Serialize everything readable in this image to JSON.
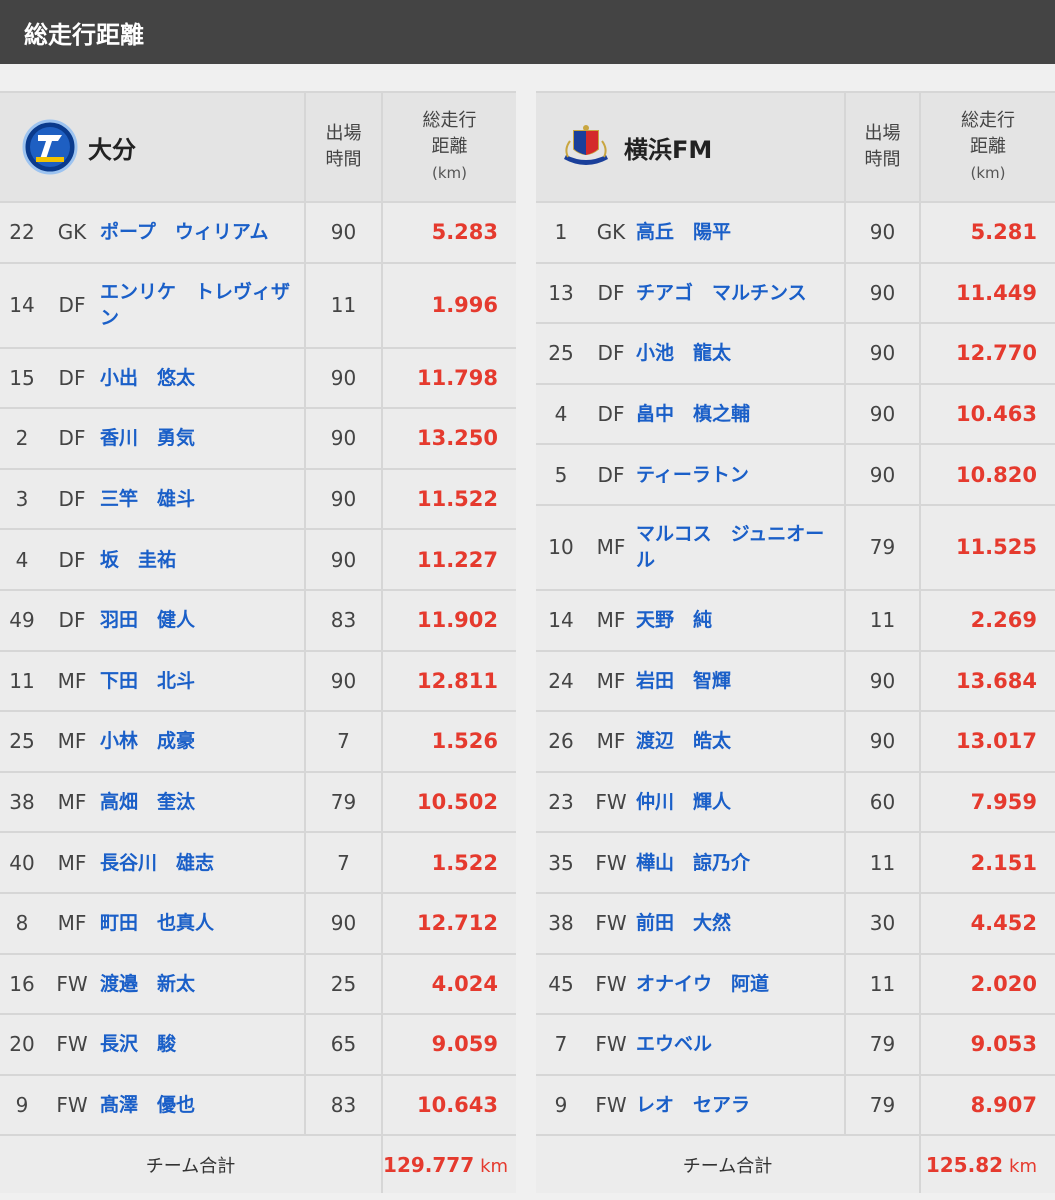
{
  "title": "総走行距離",
  "headers": {
    "minutes_l1": "出場",
    "minutes_l2": "時間",
    "dist_l1": "総走行",
    "dist_l2": "距離",
    "dist_unit": "(km)"
  },
  "total_label": "チーム合計",
  "unit": "km",
  "colors": {
    "accent": "#e53a2e",
    "link": "#1a5fc8",
    "titlebar": "#444444"
  },
  "left": {
    "team": "大分",
    "crest_icon": "oita-trinita-crest-icon",
    "players": [
      {
        "no": "22",
        "pos": "GK",
        "name": "ポープ　ウィリアム",
        "min": "90",
        "dist": "5.283"
      },
      {
        "no": "14",
        "pos": "DF",
        "name": "エンリケ　トレヴィザン",
        "min": "11",
        "dist": "1.996"
      },
      {
        "no": "15",
        "pos": "DF",
        "name": "小出　悠太",
        "min": "90",
        "dist": "11.798"
      },
      {
        "no": "2",
        "pos": "DF",
        "name": "香川　勇気",
        "min": "90",
        "dist": "13.250"
      },
      {
        "no": "3",
        "pos": "DF",
        "name": "三竿　雄斗",
        "min": "90",
        "dist": "11.522"
      },
      {
        "no": "4",
        "pos": "DF",
        "name": "坂　圭祐",
        "min": "90",
        "dist": "11.227"
      },
      {
        "no": "49",
        "pos": "DF",
        "name": "羽田　健人",
        "min": "83",
        "dist": "11.902"
      },
      {
        "no": "11",
        "pos": "MF",
        "name": "下田　北斗",
        "min": "90",
        "dist": "12.811"
      },
      {
        "no": "25",
        "pos": "MF",
        "name": "小林　成豪",
        "min": "7",
        "dist": "1.526"
      },
      {
        "no": "38",
        "pos": "MF",
        "name": "高畑　奎汰",
        "min": "79",
        "dist": "10.502"
      },
      {
        "no": "40",
        "pos": "MF",
        "name": "長谷川　雄志",
        "min": "7",
        "dist": "1.522"
      },
      {
        "no": "8",
        "pos": "MF",
        "name": "町田　也真人",
        "min": "90",
        "dist": "12.712"
      },
      {
        "no": "16",
        "pos": "FW",
        "name": "渡邉　新太",
        "min": "25",
        "dist": "4.024"
      },
      {
        "no": "20",
        "pos": "FW",
        "name": "長沢　駿",
        "min": "65",
        "dist": "9.059"
      },
      {
        "no": "9",
        "pos": "FW",
        "name": "髙澤　優也",
        "min": "83",
        "dist": "10.643"
      }
    ],
    "total": "129.777"
  },
  "right": {
    "team": "横浜FM",
    "crest_icon": "yokohama-fm-crest-icon",
    "players": [
      {
        "no": "1",
        "pos": "GK",
        "name": "高丘　陽平",
        "min": "90",
        "dist": "5.281"
      },
      {
        "no": "13",
        "pos": "DF",
        "name": "チアゴ　マルチンス",
        "min": "90",
        "dist": "11.449"
      },
      {
        "no": "25",
        "pos": "DF",
        "name": "小池　龍太",
        "min": "90",
        "dist": "12.770"
      },
      {
        "no": "4",
        "pos": "DF",
        "name": "畠中　槙之輔",
        "min": "90",
        "dist": "10.463"
      },
      {
        "no": "5",
        "pos": "DF",
        "name": "ティーラトン",
        "min": "90",
        "dist": "10.820"
      },
      {
        "no": "10",
        "pos": "MF",
        "name": "マルコス　ジュニオール",
        "min": "79",
        "dist": "11.525"
      },
      {
        "no": "14",
        "pos": "MF",
        "name": "天野　純",
        "min": "11",
        "dist": "2.269"
      },
      {
        "no": "24",
        "pos": "MF",
        "name": "岩田　智輝",
        "min": "90",
        "dist": "13.684"
      },
      {
        "no": "26",
        "pos": "MF",
        "name": "渡辺　皓太",
        "min": "90",
        "dist": "13.017"
      },
      {
        "no": "23",
        "pos": "FW",
        "name": "仲川　輝人",
        "min": "60",
        "dist": "7.959"
      },
      {
        "no": "35",
        "pos": "FW",
        "name": "樺山　諒乃介",
        "min": "11",
        "dist": "2.151"
      },
      {
        "no": "38",
        "pos": "FW",
        "name": "前田　大然",
        "min": "30",
        "dist": "4.452"
      },
      {
        "no": "45",
        "pos": "FW",
        "name": "オナイウ　阿道",
        "min": "11",
        "dist": "2.020"
      },
      {
        "no": "7",
        "pos": "FW",
        "name": "エウベル",
        "min": "79",
        "dist": "9.053"
      },
      {
        "no": "9",
        "pos": "FW",
        "name": "レオ　セアラ",
        "min": "79",
        "dist": "8.907"
      }
    ],
    "total": "125.82"
  }
}
